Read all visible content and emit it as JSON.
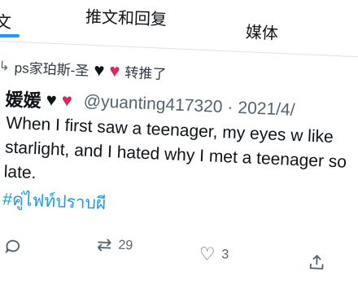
{
  "tabs": [
    {
      "label": "文"
    },
    {
      "label": "推文和回复"
    },
    {
      "label": "媒体"
    }
  ],
  "retweet": {
    "user": "ps家珀斯-圣",
    "action": "转推了"
  },
  "tweet": {
    "display_name": "媛媛",
    "handle": "@yuanting417320",
    "separator": "·",
    "date": "2021/4/",
    "text": "When I first saw a teenager, my eyes w like starlight, and I hated why I met a teenager so late.",
    "hashtag": "#คู่ไฟท์ปราบผี"
  },
  "actions": {
    "retweets": "29",
    "likes": "3"
  },
  "colors": {
    "accent": "#1d9bf0",
    "heart_red": "#e0245e",
    "muted": "#536471"
  }
}
